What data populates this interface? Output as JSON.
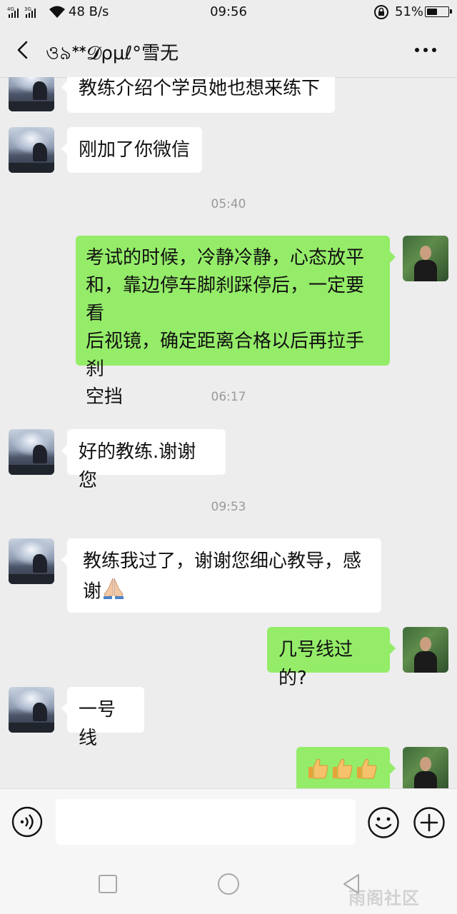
{
  "status_bar": {
    "network": "4G 3G",
    "speed": "48 B/s",
    "time": "09:56",
    "battery_percent": "51%",
    "battery_level": 0.51
  },
  "header": {
    "title": "ও৯ᕯ𝓓ρμℓ°雪无"
  },
  "messages": [
    {
      "side": "in",
      "text": "教练介绍个学员她也想来练下"
    },
    {
      "side": "in",
      "text": "刚加了你微信"
    },
    {
      "type": "time",
      "text": "05:40"
    },
    {
      "side": "out",
      "lines": [
        "考试的时候，冷静冷静，心态放平",
        "和，靠边停车脚刹踩停后，一定要看",
        "后视镜，确定距离合格以后再拉手刹",
        "空挡"
      ]
    },
    {
      "type": "time",
      "text": "06:17"
    },
    {
      "side": "in",
      "text": "好的教练.谢谢您"
    },
    {
      "type": "time",
      "text": "09:53"
    },
    {
      "side": "in",
      "lines": [
        "教练我过了，谢谢您细心教导，感",
        "谢"
      ],
      "emoji": "folded-hands"
    },
    {
      "side": "out",
      "text": "几号线过的?"
    },
    {
      "side": "in",
      "text": "一号线"
    },
    {
      "side": "out",
      "emoji": "thumbs-up ×3"
    }
  ],
  "input_bar": {
    "placeholder": "",
    "voice_icon": "voice-icon",
    "emoji_icon": "emoji-icon",
    "plus_icon": "plus-icon"
  },
  "watermark": "雨阁社区",
  "colors": {
    "background": "#ededed",
    "outgoing_bubble": "#95ec69",
    "incoming_bubble": "#ffffff",
    "timestamp": "#9a9a9a"
  }
}
